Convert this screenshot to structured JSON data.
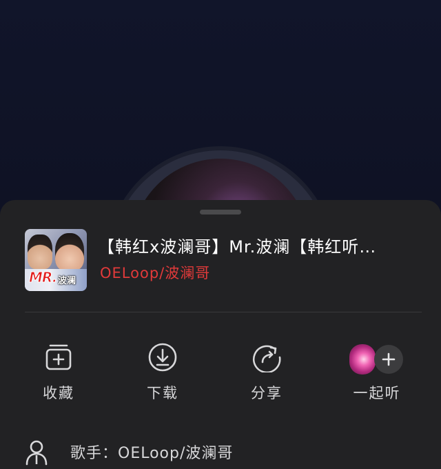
{
  "song": {
    "title": "【韩红x波澜哥】Mr.波澜【韩红听…",
    "artist": "OELoop/波澜哥",
    "cover_text_main": "MR.",
    "cover_text_sub": "波澜"
  },
  "actions": [
    {
      "label": "收藏",
      "icon": "add-to-collection-icon"
    },
    {
      "label": "下载",
      "icon": "download-icon"
    },
    {
      "label": "分享",
      "icon": "share-icon"
    },
    {
      "label": "一起听",
      "icon": "listen-together-icon"
    }
  ],
  "singer_row": {
    "text": "歌手：OELoop/波澜哥",
    "icon": "person-icon"
  },
  "colors": {
    "sheet_bg": "#222224",
    "artist_red": "#e23a3a",
    "text_primary": "#ffffff",
    "text_secondary": "#d8d8da"
  }
}
